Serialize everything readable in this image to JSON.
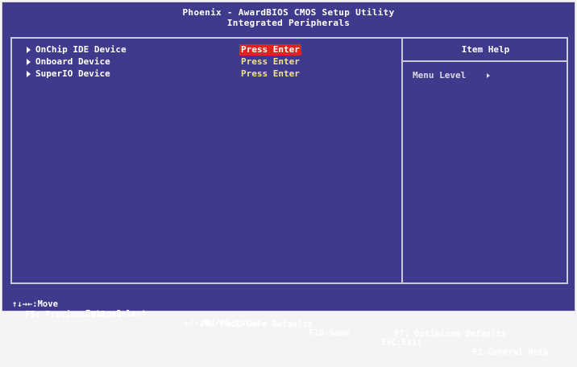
{
  "header": {
    "title": "Phoenix - AwardBIOS CMOS Setup Utility",
    "subtitle": "Integrated Peripherals"
  },
  "menu": {
    "items": [
      {
        "label": "OnChip IDE Device",
        "value": "Press Enter",
        "selected": true
      },
      {
        "label": "Onboard Device",
        "value": "Press Enter",
        "selected": false
      },
      {
        "label": "SuperIO Device",
        "value": "Press Enter",
        "selected": false
      }
    ]
  },
  "help_panel": {
    "title": "Item Help",
    "menu_level_label": "Menu Level"
  },
  "footer": {
    "row1": {
      "move": "↑↓→←:Move",
      "select": "Enter:Select",
      "value": "+/-/PU/PD:Value",
      "save": "F10:Save",
      "exit": "ESC:Exit",
      "help": "F1:General Help"
    },
    "row2": {
      "previous": "F5: Previous Values",
      "failsafe": "F6: Fail-Safe Defaults",
      "optimized": "F7: Optimized Defaults"
    }
  },
  "colors": {
    "background": "#3f3a8c",
    "frame": "#c9c9d8",
    "value_text": "#f2e48a",
    "selection": "#e0231e"
  }
}
